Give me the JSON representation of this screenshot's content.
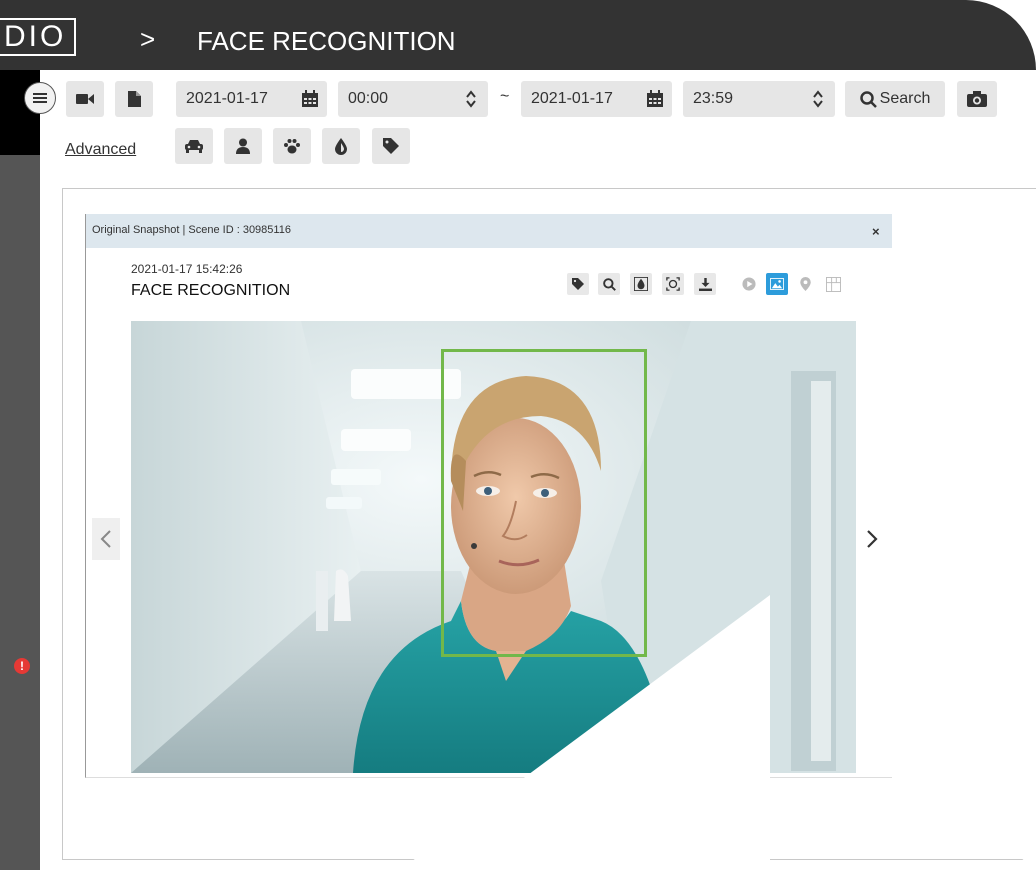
{
  "header": {
    "logo_text": "DIO",
    "separator": ">",
    "title": "FACE RECOGNITION"
  },
  "toolbar": {
    "start_date": "2021-01-17",
    "start_time": "00:00",
    "range_separator": "~",
    "end_date": "2021-01-17",
    "end_time": "23:59",
    "search_label": "Search",
    "advanced_label": "Advanced"
  },
  "dialog": {
    "header_text": "Original Snapshot | Scene ID : 30985116",
    "close_label": "×",
    "timestamp": "2021-01-17 15:42:26",
    "title": "FACE RECOGNITION"
  },
  "status": {
    "alert_label": "!"
  },
  "colors": {
    "header_bg": "#333333",
    "face_box": "#72b84a",
    "active_view": "#2d9cdb",
    "alert": "#e53935"
  },
  "icons": {
    "toolbar": [
      "menu-icon",
      "video-camera-icon",
      "file-icon",
      "calendar-icon",
      "spinner-icon",
      "search-icon",
      "camera-icon"
    ],
    "filters": [
      "car-icon",
      "person-icon",
      "paw-icon",
      "drop-icon",
      "tag-icon"
    ],
    "snapshot_tools": [
      "tag-icon",
      "zoom-icon",
      "color-icon",
      "face-detect-icon",
      "download-icon",
      "play-icon",
      "image-icon",
      "location-pin-icon",
      "layout-icon"
    ]
  }
}
